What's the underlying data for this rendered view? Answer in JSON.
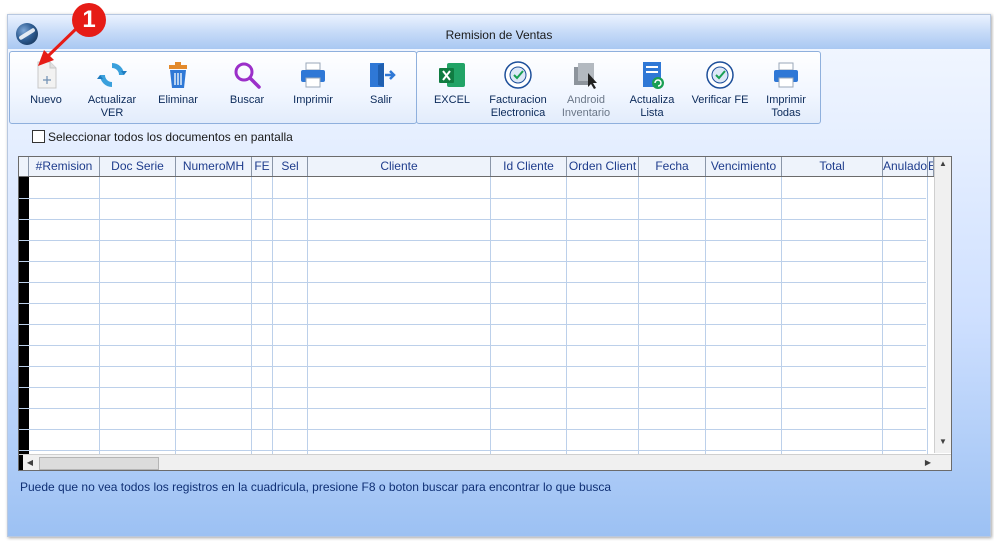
{
  "window": {
    "title": "Remision de Ventas"
  },
  "toolbar": {
    "group1": [
      {
        "id": "nuevo",
        "label": "Nuevo",
        "icon": "new-document-icon"
      },
      {
        "id": "actualizar",
        "label": "Actualizar\nVER",
        "icon": "refresh-icon"
      },
      {
        "id": "eliminar",
        "label": "Eliminar",
        "icon": "trash-icon"
      },
      {
        "id": "buscar",
        "label": "Buscar",
        "icon": "magnifier-icon"
      },
      {
        "id": "imprimir",
        "label": "Imprimir",
        "icon": "printer-icon"
      },
      {
        "id": "salir",
        "label": "Salir",
        "icon": "exit-door-icon"
      }
    ],
    "group2": [
      {
        "id": "excel",
        "label": "EXCEL",
        "icon": "excel-icon"
      },
      {
        "id": "facturacion",
        "label": "Facturacion\nElectronica",
        "icon": "e-invoice-seal-icon"
      },
      {
        "id": "android",
        "label": "Android\nInventario",
        "icon": "android-inventory-icon"
      },
      {
        "id": "actualiza-lista",
        "label": "Actualiza\nLista",
        "icon": "list-refresh-icon"
      },
      {
        "id": "verificar-fe",
        "label": "Verificar FE",
        "icon": "verify-seal-icon"
      },
      {
        "id": "imprimir-todas",
        "label": "Imprimir\nTodas",
        "icon": "printer-all-icon"
      }
    ]
  },
  "select_all": {
    "label": "Seleccionar todos los documentos en pantalla",
    "checked": false
  },
  "grid": {
    "columns": [
      "#Remision",
      "Doc Serie",
      "NumeroMH",
      "FE",
      "Sel",
      "Cliente",
      "Id Cliente",
      "Orden Client",
      "Fecha",
      "Vencimiento",
      "Total",
      "Anulado",
      "E"
    ],
    "rows": []
  },
  "hint": "Puede que no vea todos los registros en la cuadricula, presione F8 o boton buscar para encontrar lo que busca",
  "annotation": {
    "badge": "1"
  },
  "colors": {
    "accent_blue": "#2f78d6",
    "badge_red": "#e61c16",
    "header_text": "#1e3c8c",
    "grid_line": "#bcd0ea"
  }
}
